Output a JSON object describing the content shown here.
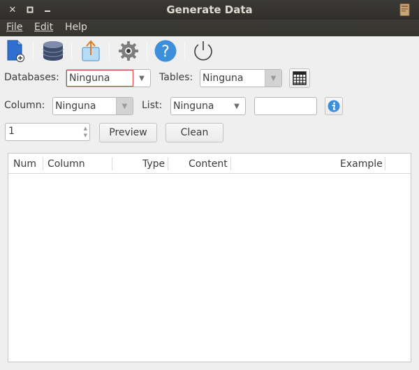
{
  "window": {
    "title": "Generate Data"
  },
  "menu": {
    "file": "File",
    "edit": "Edit",
    "help": "Help"
  },
  "toolbar": {
    "icons": [
      "new-file-icon",
      "database-icon",
      "export-icon",
      "settings-gear-icon",
      "help-icon",
      "power-icon"
    ]
  },
  "form": {
    "databases_label": "Databases:",
    "databases_value": "Ninguna",
    "tables_label": "Tables:",
    "tables_value": "Ninguna",
    "column_label": "Column:",
    "column_value": "Ninguna",
    "list_label": "List:",
    "list_value": "Ninguna",
    "list_filter_value": "",
    "count_value": "1",
    "preview_label": "Preview",
    "clean_label": "Clean"
  },
  "table": {
    "columns": [
      "Num",
      "Column",
      "Type",
      "Content",
      "Example"
    ],
    "rows": []
  },
  "colors": {
    "titlebar": "#3b3a36",
    "window_bg": "#efefef",
    "focus_border": "#e04040",
    "accent_blue": "#3d8fd9"
  }
}
